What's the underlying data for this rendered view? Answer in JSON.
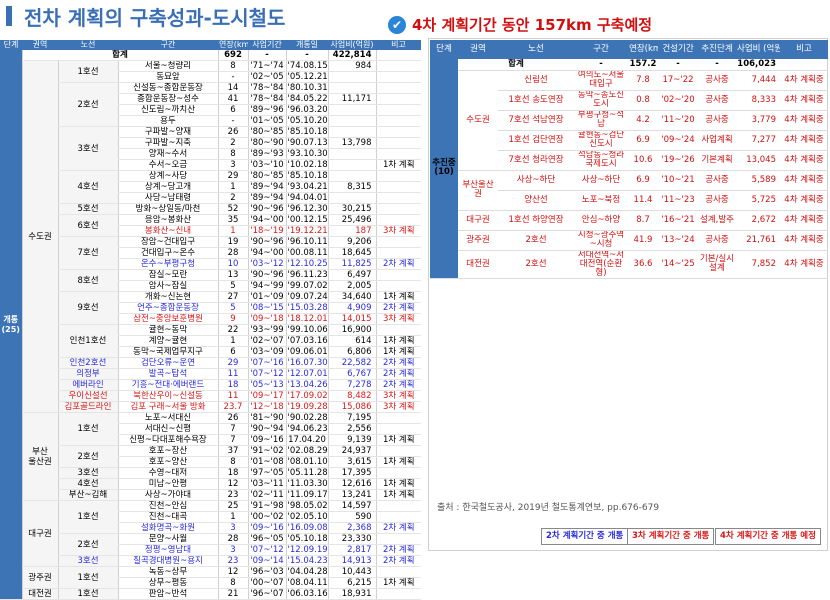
{
  "title": "전차 계획의 구축성과-도시철도",
  "subtitle": "4차 계획기간 동안 157km 구축예정",
  "left_table": {
    "headers": [
      "단계",
      "권역",
      "노선",
      "구간",
      "연장(km)",
      "사업기간",
      "개통일",
      "사업비(억원)",
      "비고"
    ],
    "category": "개통\n(25)",
    "total": {
      "label": "합계",
      "length": "692",
      "period": "-",
      "open": "-",
      "cost": "422,814",
      "note": ""
    },
    "rows": [
      {
        "region": "수도권",
        "line": "1호선",
        "section": "서울~청량리",
        "length": "8",
        "period": "'71~'74",
        "open": "'74.08.15",
        "cost": "984",
        "note": "",
        "color": ""
      },
      {
        "region": "",
        "line": "",
        "section": "동묘앞",
        "length": "-",
        "period": "'02~'05",
        "open": "'05.12.21",
        "cost": "",
        "note": "",
        "color": ""
      },
      {
        "region": "",
        "line": "2호선",
        "section": "신설동~종합운동장",
        "length": "14",
        "period": "'78~'84",
        "open": "'80.10.31",
        "cost": "",
        "note": "",
        "color": ""
      },
      {
        "region": "",
        "line": "",
        "section": "종합운동장~성수",
        "length": "41",
        "period": "'78~'84",
        "open": "'84.05.22",
        "cost": "11,171",
        "note": "",
        "color": ""
      },
      {
        "region": "",
        "line": "",
        "section": "신도림~까치산",
        "length": "6",
        "period": "'89~'96",
        "open": "'96.03.20",
        "cost": "",
        "note": "",
        "color": ""
      },
      {
        "region": "",
        "line": "",
        "section": "용두",
        "length": "-",
        "period": "'01~'05",
        "open": "'05.10.20",
        "cost": "",
        "note": "",
        "color": ""
      },
      {
        "region": "",
        "line": "3호선",
        "section": "구파발~양재",
        "length": "26",
        "period": "'80~'85",
        "open": "'85.10.18",
        "cost": "",
        "note": "",
        "color": ""
      },
      {
        "region": "",
        "line": "",
        "section": "구파발~지축",
        "length": "2",
        "period": "'80~'90",
        "open": "'90.07.13",
        "cost": "13,798",
        "note": "",
        "color": ""
      },
      {
        "region": "",
        "line": "",
        "section": "양재~수서",
        "length": "8",
        "period": "'89~'93",
        "open": "'93.10.30",
        "cost": "",
        "note": "",
        "color": ""
      },
      {
        "region": "",
        "line": "",
        "section": "수서~오금",
        "length": "3",
        "period": "'03~'10",
        "open": "'10.02.18",
        "cost": "",
        "note": "1차 계획",
        "color": ""
      },
      {
        "region": "",
        "line": "4호선",
        "section": "상계~사당",
        "length": "29",
        "period": "'80~'85",
        "open": "'85.10.18",
        "cost": "",
        "note": "",
        "color": ""
      },
      {
        "region": "",
        "line": "",
        "section": "상계~당고개",
        "length": "1",
        "period": "'89~'94",
        "open": "'93.04.21",
        "cost": "8,315",
        "note": "",
        "color": ""
      },
      {
        "region": "",
        "line": "",
        "section": "사당~남태령",
        "length": "2",
        "period": "'89~'94",
        "open": "'94.04.01",
        "cost": "",
        "note": "",
        "color": ""
      },
      {
        "region": "",
        "line": "5호선",
        "section": "방화~상일동/마천",
        "length": "52",
        "period": "'90~'96",
        "open": "'96.12.30",
        "cost": "30,215",
        "note": "",
        "color": ""
      },
      {
        "region": "",
        "line": "6호선",
        "section": "응암~봉화산",
        "length": "35",
        "period": "'94~'00",
        "open": "'00.12.15",
        "cost": "25,496",
        "note": "",
        "color": ""
      },
      {
        "region": "",
        "line": "",
        "section": "봉화산~신내",
        "length": "1",
        "period": "'18~'19",
        "open": "'19.12.21",
        "cost": "187",
        "note": "3차 계획",
        "color": "red"
      },
      {
        "region": "",
        "line": "7호선",
        "section": "장암~건대입구",
        "length": "19",
        "period": "'90~'96",
        "open": "'96.10.11",
        "cost": "9,206",
        "note": "",
        "color": ""
      },
      {
        "region": "",
        "line": "",
        "section": "건대입구~온수",
        "length": "28",
        "period": "'94~'00",
        "open": "'00.08.11",
        "cost": "18,645",
        "note": "",
        "color": ""
      },
      {
        "region": "",
        "line": "",
        "section": "온수~부평구청",
        "length": "10",
        "period": "'03~'12",
        "open": "'12.10.25",
        "cost": "11,825",
        "note": "2차 계획",
        "color": "blue"
      },
      {
        "region": "",
        "line": "8호선",
        "section": "잠실~모란",
        "length": "13",
        "period": "'90~'96",
        "open": "'96.11.23",
        "cost": "6,497",
        "note": "",
        "color": ""
      },
      {
        "region": "",
        "line": "",
        "section": "암사~잠실",
        "length": "5",
        "period": "'94~'99",
        "open": "'99.07.02",
        "cost": "2,005",
        "note": "",
        "color": ""
      },
      {
        "region": "",
        "line": "9호선",
        "section": "개화~신논현",
        "length": "27",
        "period": "'01~'09",
        "open": "'09.07.24",
        "cost": "34,640",
        "note": "1차 계획",
        "color": ""
      },
      {
        "region": "",
        "line": "",
        "section": "언주~종합운동장",
        "length": "5",
        "period": "'08~'15",
        "open": "'15.03.28",
        "cost": "4,909",
        "note": "2차 계획",
        "color": "blue"
      },
      {
        "region": "",
        "line": "",
        "section": "삼전~중앙보훈병원",
        "length": "9",
        "period": "'09~'18",
        "open": "'18.12.01",
        "cost": "14,015",
        "note": "3차 계획",
        "color": "red"
      },
      {
        "region": "",
        "line": "인천1호선",
        "section": "귤현~동막",
        "length": "22",
        "period": "'93~'99",
        "open": "'99.10.06",
        "cost": "16,900",
        "note": "",
        "color": ""
      },
      {
        "region": "",
        "line": "",
        "section": "계양~귤현",
        "length": "1",
        "period": "'02~'07",
        "open": "'07.03.16",
        "cost": "614",
        "note": "1차 계획",
        "color": ""
      },
      {
        "region": "",
        "line": "",
        "section": "동막~국제업무지구",
        "length": "6",
        "period": "'03~'09",
        "open": "'09.06.01",
        "cost": "6,806",
        "note": "1차 계획",
        "color": ""
      },
      {
        "region": "",
        "line": "인천2호선",
        "section": "검단오류~운연",
        "length": "29",
        "period": "'07~'16",
        "open": "'16.07.30",
        "cost": "22,582",
        "note": "2차 계획",
        "color": "blue"
      },
      {
        "region": "",
        "line": "의정부",
        "section": "발곡~탑석",
        "length": "11",
        "period": "'07~'12",
        "open": "'12.07.01",
        "cost": "6,767",
        "note": "2차 계획",
        "color": "blue"
      },
      {
        "region": "",
        "line": "에버라인",
        "section": "기흥~전대·에버랜드",
        "length": "18",
        "period": "'05~'13",
        "open": "'13.04.26",
        "cost": "7,278",
        "note": "2차 계획",
        "color": "blue"
      },
      {
        "region": "",
        "line": "우이신설선",
        "section": "북한산우이~신설동",
        "length": "11",
        "period": "'09~'17",
        "open": "'17.09.02",
        "cost": "8,482",
        "note": "3차 계획",
        "color": "red"
      },
      {
        "region": "",
        "line": "김포골드라인",
        "section": "김포 구래~서울 방화",
        "length": "23.7",
        "period": "'12~'18",
        "open": "'19.09.28",
        "cost": "15,086",
        "note": "3차 계획",
        "color": "red"
      },
      {
        "region": "부산\n울산권",
        "line": "1호선",
        "section": "노포~서대신",
        "length": "26",
        "period": "'81~'90",
        "open": "'90.02.28",
        "cost": "7,195",
        "note": "",
        "color": ""
      },
      {
        "region": "",
        "line": "",
        "section": "서대신~신평",
        "length": "7",
        "period": "'90~'94",
        "open": "'94.06.23",
        "cost": "2,556",
        "note": "",
        "color": ""
      },
      {
        "region": "",
        "line": "",
        "section": "신평~다대포해수욕장",
        "length": "7",
        "period": "'09~'16",
        "open": "17.04.20",
        "cost": "9,139",
        "note": "1차 계획",
        "color": ""
      },
      {
        "region": "",
        "line": "2호선",
        "section": "호포~장산",
        "length": "37",
        "period": "'91~'02",
        "open": "'02.08.29",
        "cost": "24,937",
        "note": "",
        "color": ""
      },
      {
        "region": "",
        "line": "",
        "section": "호포~양산",
        "length": "8",
        "period": "'01~'08",
        "open": "'08.01.10",
        "cost": "3,615",
        "note": "1차 계획",
        "color": ""
      },
      {
        "region": "",
        "line": "3호선",
        "section": "수영~대저",
        "length": "18",
        "period": "'97~'05",
        "open": "'05.11.28",
        "cost": "17,395",
        "note": "",
        "color": ""
      },
      {
        "region": "",
        "line": "4호선",
        "section": "미남~안평",
        "length": "12",
        "period": "'03~'11",
        "open": "'11.03.30",
        "cost": "12,616",
        "note": "1차 계획",
        "color": ""
      },
      {
        "region": "",
        "line": "부산~김해",
        "section": "사상~가야대",
        "length": "23",
        "period": "'02~'11",
        "open": "'11.09.17",
        "cost": "13,241",
        "note": "1차 계획",
        "color": ""
      },
      {
        "region": "대구권",
        "line": "1호선",
        "section": "진천~안심",
        "length": "25",
        "period": "'91~'98",
        "open": "'98.05.02",
        "cost": "14,597",
        "note": "",
        "color": ""
      },
      {
        "region": "",
        "line": "",
        "section": "진천~대곡",
        "length": "1",
        "period": "'00~'02",
        "open": "'02.05.10",
        "cost": "590",
        "note": "",
        "color": ""
      },
      {
        "region": "",
        "line": "",
        "section": "설화명곡~화원",
        "length": "3",
        "period": "'09~'16",
        "open": "'16.09.08",
        "cost": "2,368",
        "note": "2차 계획",
        "color": "blue"
      },
      {
        "region": "",
        "line": "2호선",
        "section": "문양~사월",
        "length": "28",
        "period": "'96~'05",
        "open": "'05.10.18",
        "cost": "23,330",
        "note": "",
        "color": ""
      },
      {
        "region": "",
        "line": "",
        "section": "정평~영남대",
        "length": "3",
        "period": "'07~'12",
        "open": "'12.09.19",
        "cost": "2,817",
        "note": "2차 계획",
        "color": "blue"
      },
      {
        "region": "",
        "line": "3호선",
        "section": "칠곡경대병원~용지",
        "length": "23",
        "period": "'09~'14",
        "open": "'15.04.23",
        "cost": "14,913",
        "note": "2차 계획",
        "color": "blue"
      },
      {
        "region": "광주권",
        "line": "1호선",
        "section": "녹동~상무",
        "length": "12",
        "period": "'96~'03",
        "open": "'04.04.28",
        "cost": "10,443",
        "note": "",
        "color": ""
      },
      {
        "region": "",
        "line": "",
        "section": "상무~평동",
        "length": "8",
        "period": "'00~'07",
        "open": "'08.04.11",
        "cost": "6,215",
        "note": "1차 계획",
        "color": ""
      },
      {
        "region": "대전권",
        "line": "1호선",
        "section": "판암~반석",
        "length": "21",
        "period": "'96~'07",
        "open": "'06.03.16",
        "cost": "18,931",
        "note": "",
        "color": ""
      }
    ]
  },
  "right_table": {
    "headers": [
      "단계",
      "권역",
      "노선",
      "구간",
      "연장(km)",
      "건설기간",
      "추진단계",
      "사업비\n(억원)",
      "비고"
    ],
    "category": "추진중\n(10)",
    "total": {
      "label": "합계",
      "section": "-",
      "length": "157.2",
      "period": "-",
      "stage": "-",
      "cost": "106,023",
      "note": ""
    },
    "rows": [
      {
        "region": "수도권",
        "line": "신림선",
        "section": "여의도~서울대입구",
        "length": "7.8",
        "period": "17~'22",
        "stage": "공사중",
        "cost": "7,444",
        "note": "4차 계획중"
      },
      {
        "region": "",
        "line": "1호선 송도연장",
        "section": "동막~송도신도시",
        "length": "0.8",
        "period": "'02~'20",
        "stage": "공사중",
        "cost": "8,333",
        "note": "4차 계획중"
      },
      {
        "region": "",
        "line": "7호선 석남연장",
        "section": "부평구청~석남",
        "length": "4.2",
        "period": "'11~'20",
        "stage": "공사중",
        "cost": "3,779",
        "note": "4차 계획중"
      },
      {
        "region": "",
        "line": "1호선 검단연장",
        "section": "귤현동~검단신도시",
        "length": "6.9",
        "period": "'09~'24",
        "stage": "사업계획",
        "cost": "7,277",
        "note": "4차 계획중"
      },
      {
        "region": "",
        "line": "7호선 청라연장",
        "section": "석남동~청라국제도시",
        "length": "10.6",
        "period": "'19~'26",
        "stage": "기본계획",
        "cost": "13,045",
        "note": "4차 계획중"
      },
      {
        "region": "부산울산권",
        "line": "사상~하단",
        "section": "사상~하단",
        "length": "6.9",
        "period": "'10~'21",
        "stage": "공사중",
        "cost": "5,589",
        "note": "4차 계획중"
      },
      {
        "region": "",
        "line": "양산선",
        "section": "노포~북정",
        "length": "11.4",
        "period": "'11~'23",
        "stage": "공사중",
        "cost": "5,725",
        "note": "4차 계획중"
      },
      {
        "region": "대구권",
        "line": "1호선 하양연장",
        "section": "안심~하양",
        "length": "8.7",
        "period": "'16~'21",
        "stage": "설계,발주",
        "cost": "2,672",
        "note": "4차 계획중"
      },
      {
        "region": "광주권",
        "line": "2호선",
        "section": "시청~광주역~시청",
        "length": "41.9",
        "period": "'13~'24",
        "stage": "공사중",
        "cost": "21,761",
        "note": "4차 계획중"
      },
      {
        "region": "대전권",
        "line": "2호선",
        "section": "서대전역~서대전역(순환형)",
        "length": "36.6",
        "period": "'14~'25",
        "stage": "기본/실시설계",
        "cost": "7,852",
        "note": "4차 계획중"
      }
    ]
  },
  "source": "출처 : 한국철도공사, 2019년 철도통계연보, pp.676-679",
  "legend": [
    {
      "label": "2차 계획기간 중 개통",
      "color": "#2a2ad8"
    },
    {
      "label": "3차 계획기간 중 개통",
      "color": "#d81818"
    },
    {
      "label": "4차 계획기간 중 개통 예정",
      "color": "#d81818"
    }
  ],
  "colors": {
    "header_blue": "#3d74b6",
    "red": "#d01010",
    "blue": "#2a2ad8",
    "check_icon": "#2a84d8"
  }
}
